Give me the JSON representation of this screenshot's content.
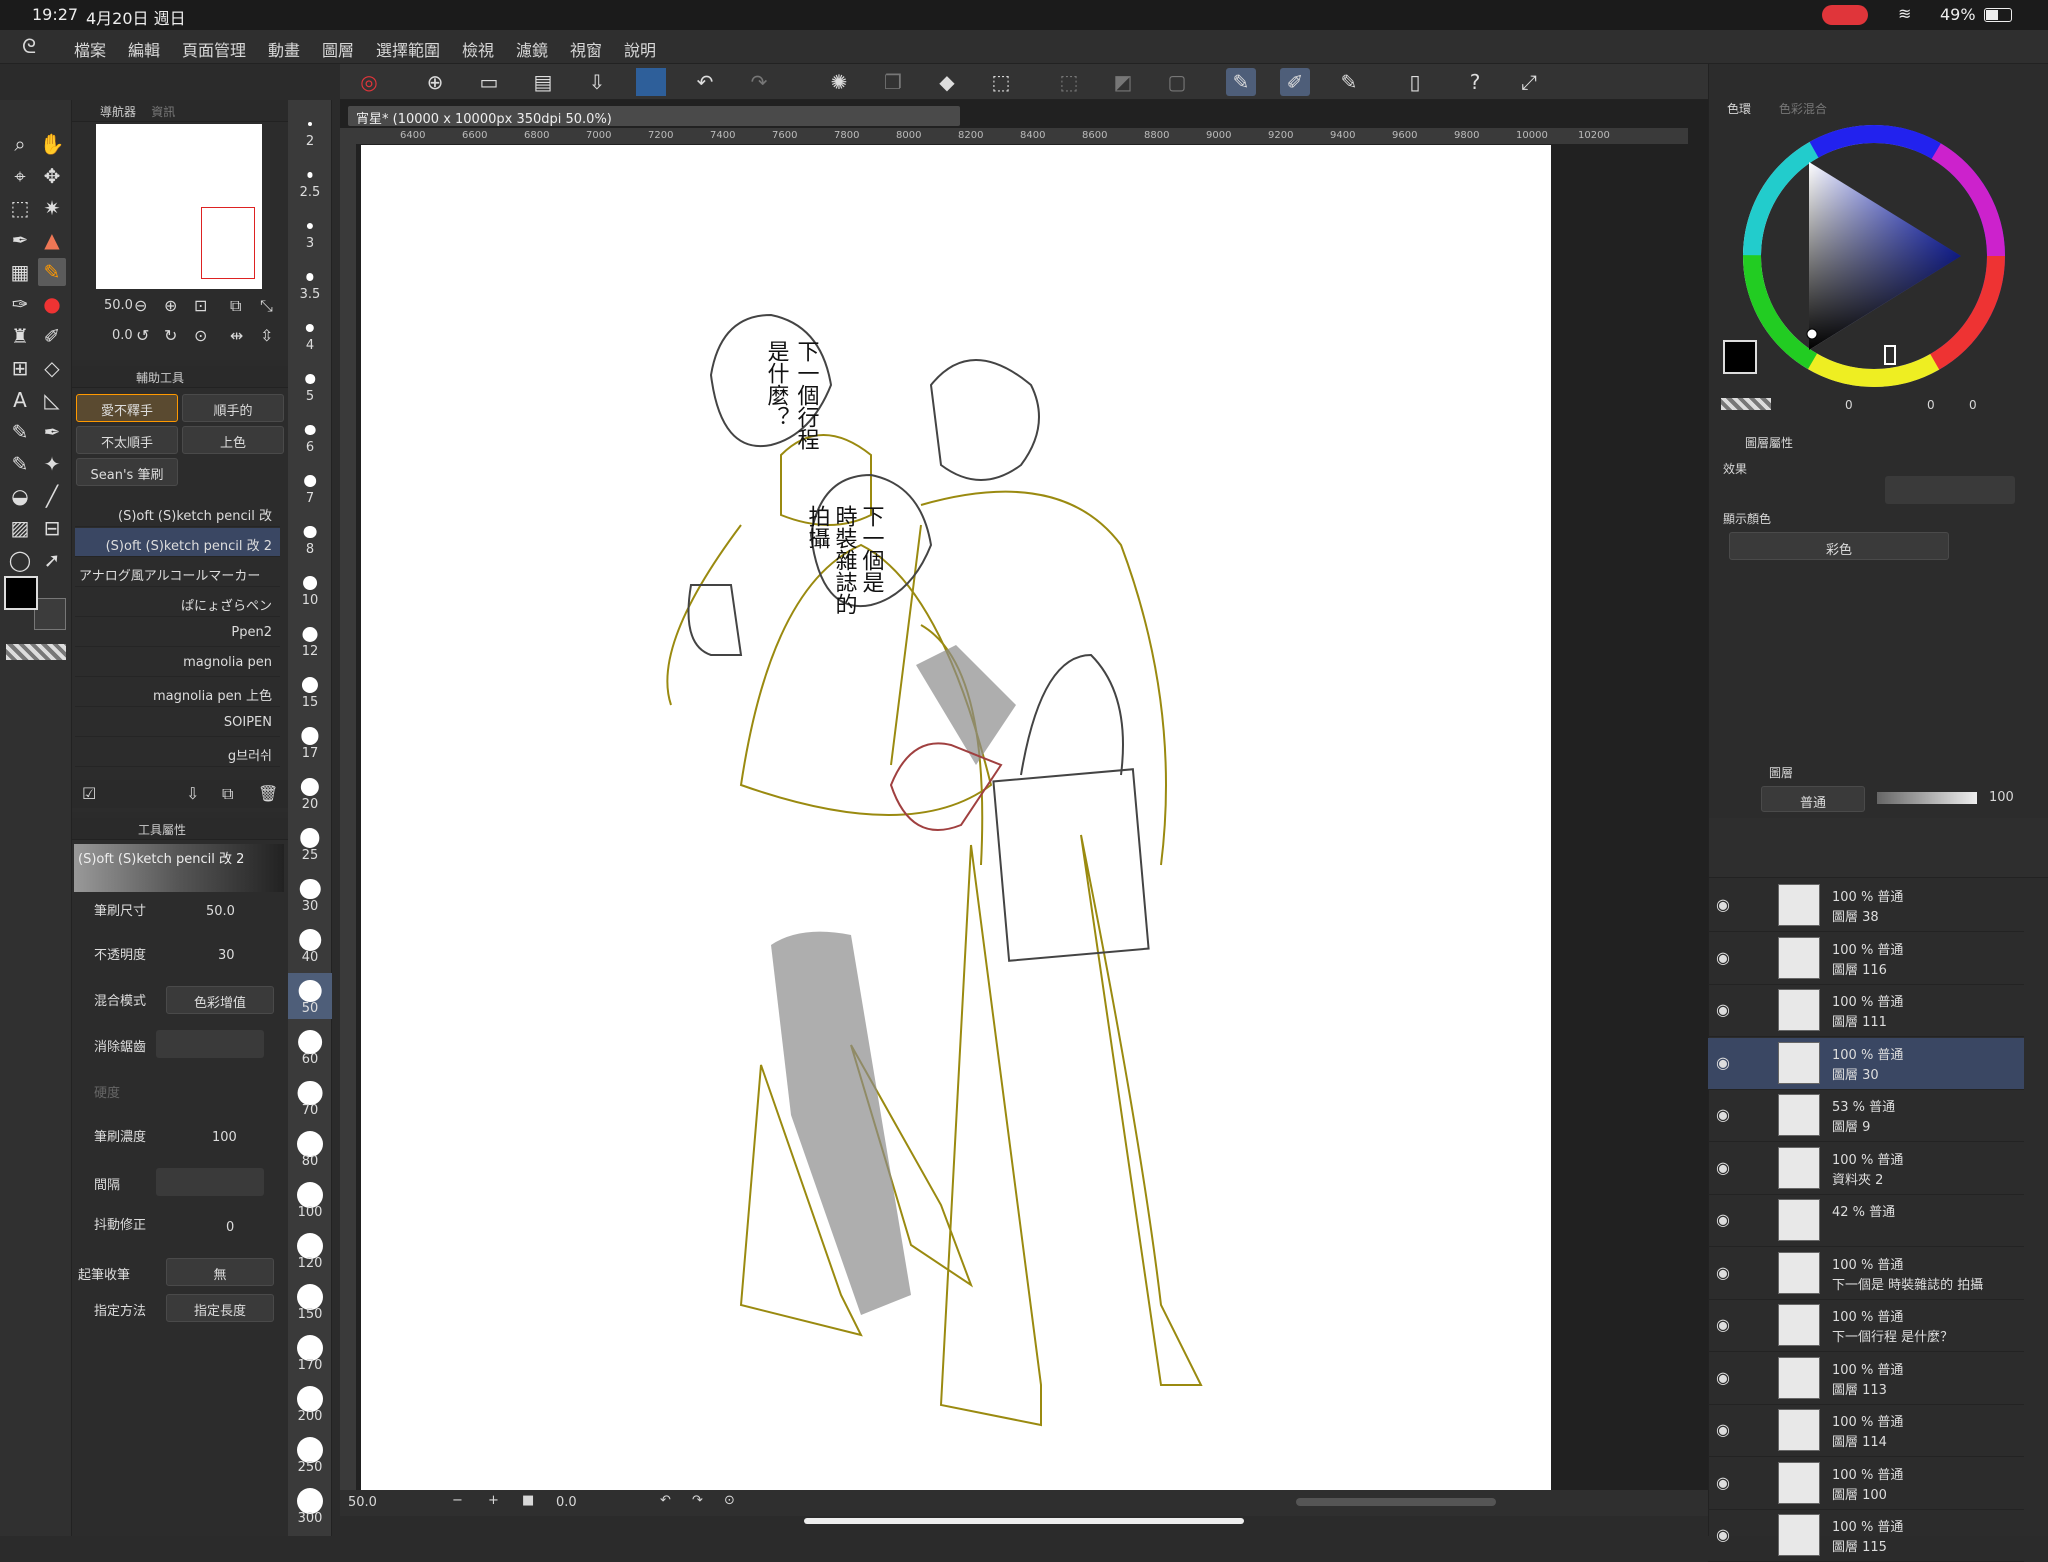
{
  "status": {
    "time": "19:27",
    "date": "4月20日 週日",
    "battery": "49%"
  },
  "menu": [
    "檔案",
    "編輯",
    "頁面管理",
    "動畫",
    "圖層",
    "選擇範圍",
    "檢視",
    "濾鏡",
    "視窗",
    "說明"
  ],
  "doc_tab": "宵星* (10000 x 10000px 350dpi 50.0%)",
  "ruler_ticks": [
    "6400",
    "6600",
    "6800",
    "7000",
    "7200",
    "7400",
    "7600",
    "7800",
    "8000",
    "8200",
    "8400",
    "8600",
    "8800",
    "9000",
    "9200",
    "9400",
    "9600",
    "9800",
    "10000",
    "10200"
  ],
  "navigator": {
    "title": "導航器",
    "tab2": "資訊",
    "zoom": "50.0",
    "angle": "0.0"
  },
  "subtool": {
    "title": "輔助工具",
    "items": [
      "愛不釋手",
      "順手的",
      "不太順手",
      "上色",
      "Sean's 筆刷"
    ],
    "brushes": [
      "(S)oft (S)ketch pencil 改",
      "(S)oft (S)ketch pencil 改 2",
      "アナログ風アルコールマーカー",
      "ぱにょざらペン",
      "Ppen2",
      "magnolia pen",
      "magnolia pen 上色",
      "SOIPEN",
      "g브러쉬"
    ]
  },
  "tool_props": {
    "title": "工具屬性",
    "brush_name": "(S)oft (S)ketch pencil 改 2",
    "labels": {
      "size": "筆刷尺寸",
      "opacity": "不透明度",
      "blend": "混合模式",
      "aa": "消除鋸齒",
      "hardness": "硬度",
      "density": "筆刷濃度",
      "interval": "間隔",
      "stabilize": "抖動修正",
      "taper": "起筆收筆",
      "spec": "指定方法"
    },
    "values": {
      "size": "50.0",
      "opacity": "30",
      "blend": "色彩增值",
      "density": "100",
      "stabilize": "0",
      "taper": "無",
      "spec": "指定長度"
    }
  },
  "size_list": [
    "2",
    "2.5",
    "3",
    "3.5",
    "4",
    "5",
    "6",
    "7",
    "8",
    "10",
    "12",
    "15",
    "17",
    "20",
    "25",
    "30",
    "40",
    "50",
    "60",
    "70",
    "80",
    "100",
    "120",
    "150",
    "170",
    "200",
    "250",
    "300"
  ],
  "color_panel": {
    "tab1": "色環",
    "tab2": "色彩混合",
    "r": "0",
    "g": "0",
    "b": "0"
  },
  "layer_props": {
    "tab": "圖層屬性",
    "effect": "效果",
    "display_color": "顯示顏色",
    "color_mode": "彩色"
  },
  "layers_panel": {
    "title": "圖層",
    "blend": "普通",
    "opacity": "100"
  },
  "layers": [
    {
      "op": "100 %  普通",
      "name": "圖層 38"
    },
    {
      "op": "100 %  普通",
      "name": "圖層 116"
    },
    {
      "op": "100 %  普通",
      "name": "圖層 111"
    },
    {
      "op": "100 %  普通",
      "name": "圖層 30",
      "selected": true
    },
    {
      "op": "53 %  普通",
      "name": "圖層 9"
    },
    {
      "op": "100 %  普通",
      "name": "資料夾 2"
    },
    {
      "op": "42 %  普通",
      "name": ""
    },
    {
      "op": "100 %  普通",
      "name": "下一個是 時裝雜誌的 拍攝"
    },
    {
      "op": "100 %  普通",
      "name": "下一個行程 是什麼？"
    },
    {
      "op": "100 %  普通",
      "name": "圖層 113"
    },
    {
      "op": "100 %  普通",
      "name": "圖層 114"
    },
    {
      "op": "100 %  普通",
      "name": "圖層 100"
    },
    {
      "op": "100 %  普通",
      "name": "圖層 115"
    }
  ],
  "speech": {
    "bubble1": [
      "下一個行程",
      "是什麼？"
    ],
    "bubble2": [
      "下一個是",
      "時裝雜誌的",
      "拍攝"
    ]
  },
  "bottom": {
    "zoom": "50.0",
    "angle": "0.0"
  }
}
